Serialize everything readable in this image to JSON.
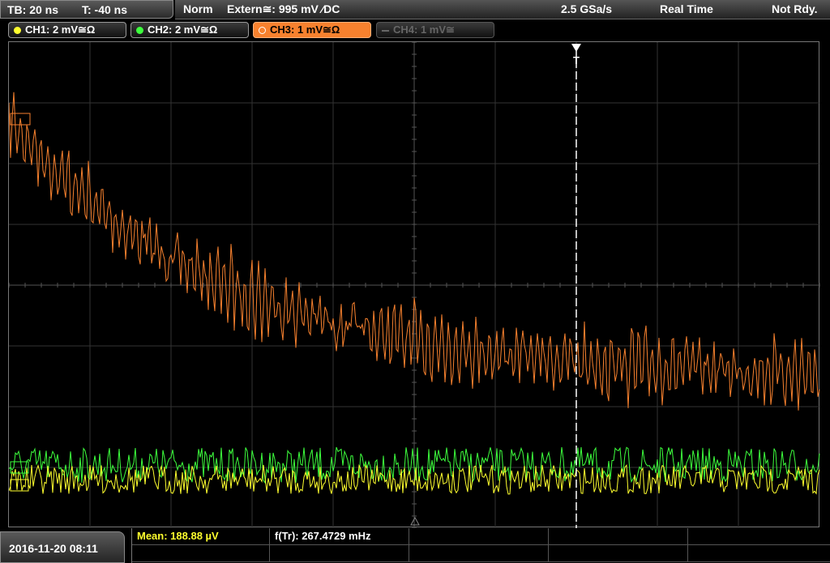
{
  "header": {
    "timebase": "TB: 20 ns",
    "trigger_time": "T: -40 ns",
    "mode": "Norm",
    "trigger_source": "Extern≅: 995 mV ⁄DC",
    "sample_rate": "2.5 GSa/s",
    "acq_mode": "Real Time",
    "state": "Not Rdy."
  },
  "channels": [
    {
      "label": "CH1: 2 mV≅Ω",
      "color": "#ffff2e",
      "state": "on"
    },
    {
      "label": "CH2: 2 mV≅Ω",
      "color": "#3dff3d",
      "state": "on"
    },
    {
      "label": "CH3: 1 mV≅Ω",
      "color": "#f7812e",
      "state": "active"
    },
    {
      "label": "CH4: 1 mV≅",
      "color": "#666666",
      "state": "off"
    }
  ],
  "trigger_marker": "T",
  "footer": {
    "datetime": "2016-11-20 08:11",
    "mean_label": "Mean: 188.88 µV",
    "freq_label": "f(Tr): 267.4729 mHz"
  },
  "colors": {
    "ch3": "#f7812e",
    "ch1": "#ffff2e",
    "ch2": "#3dff3d",
    "grid": "#3a3a3a"
  }
}
